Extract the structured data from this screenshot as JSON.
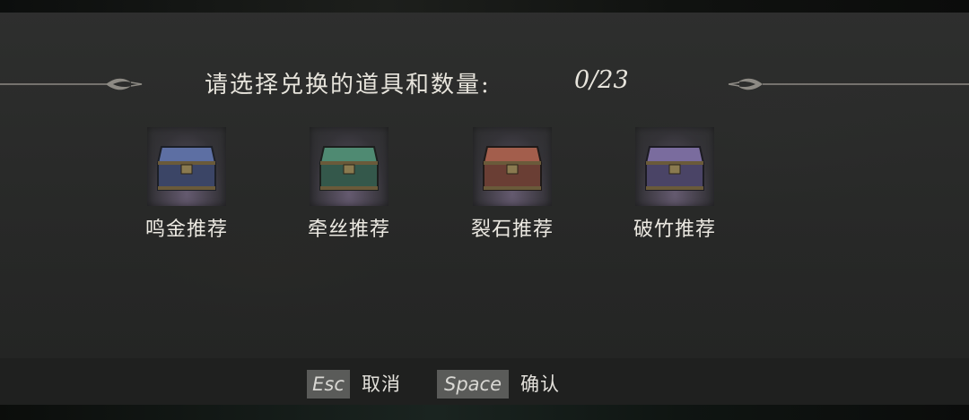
{
  "dialog": {
    "title": "请选择兑换的道具和数量:",
    "count": "0/23"
  },
  "items": [
    {
      "label": "鸣金推荐",
      "icon": "blue-chest-icon",
      "color": "#5d6fa3"
    },
    {
      "label": "牵丝推荐",
      "icon": "green-chest-icon",
      "color": "#4f8a72"
    },
    {
      "label": "裂石推荐",
      "icon": "red-chest-icon",
      "color": "#a35e4c"
    },
    {
      "label": "破竹推荐",
      "icon": "purple-chest-icon",
      "color": "#7a6c9e"
    }
  ],
  "footer": {
    "cancel_key": "Esc",
    "cancel_label": "取消",
    "confirm_key": "Space",
    "confirm_label": "确认"
  }
}
